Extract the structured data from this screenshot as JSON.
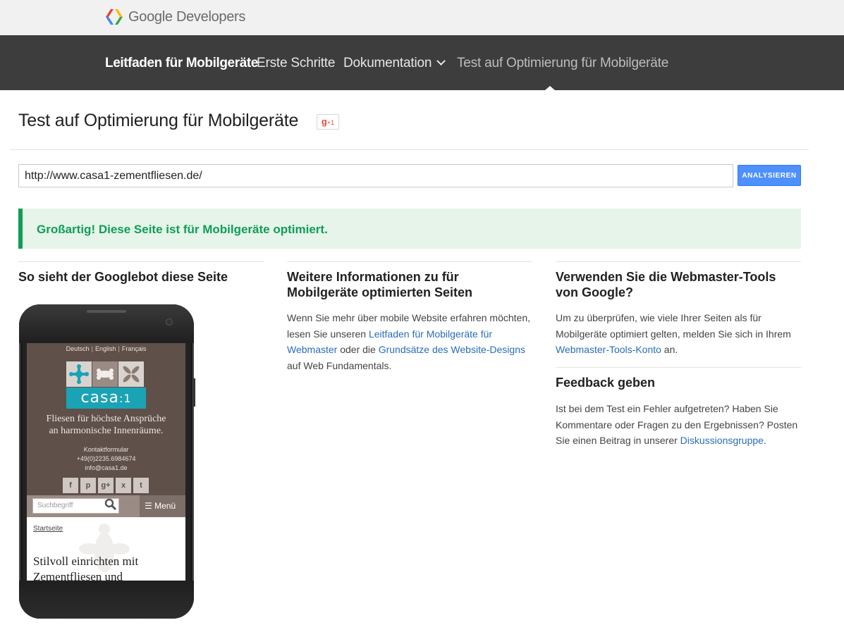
{
  "header": {
    "logo_text": "Google Developers"
  },
  "nav": {
    "brand": "Leitfaden für Mobilgeräte",
    "items": [
      {
        "label": "Erste Schritte"
      },
      {
        "label": "Dokumentation"
      },
      {
        "label": "Test auf Optimierung für Mobilgeräte"
      }
    ]
  },
  "page": {
    "title": "Test auf Optimierung für Mobilgeräte",
    "gplus_label": "g",
    "gplus_count": "+1"
  },
  "form": {
    "url_value": "http://www.casa1-zementfliesen.de/",
    "analyze_label": "ANALYSIEREN"
  },
  "result": {
    "message": "Großartig! Diese Seite ist für Mobilgeräte optimiert."
  },
  "columns": {
    "googlebot": {
      "heading": "So sieht der Googlebot diese Seite"
    },
    "info": {
      "heading": "Weitere Informationen zu für Mobilgeräte optimierten Seiten",
      "text_1": "Wenn Sie mehr über mobile Website erfahren möchten, lesen Sie unseren ",
      "link_1": "Leitfaden für Mobilgeräte für Webmaster",
      "text_2": " oder die ",
      "link_2": "Grundsätze des Website-Designs",
      "text_3": " auf Web Fundamentals."
    },
    "webmaster": {
      "heading": "Verwenden Sie die Webmaster-Tools von Google?",
      "text_1": "Um zu überprüfen, wie viele Ihrer Seiten als für Mobilgeräte optimiert gelten, melden Sie sich in Ihrem ",
      "link_1": "Webmaster-Tools-Konto",
      "text_2": " an."
    },
    "feedback": {
      "heading": "Feedback geben",
      "text_1": "Ist bei dem Test ein Fehler aufgetreten? Haben Sie Kommentare oder Fragen zu den Ergebnissen? Posten Sie einen Beitrag in unserer ",
      "link_1": "Diskussionsgruppe",
      "text_2": "."
    }
  },
  "preview": {
    "languages": [
      "Deutsch",
      "English",
      "Français"
    ],
    "brand_name": "casa",
    "brand_suffix": ":1",
    "tagline_1": "Fliesen für höchste Ansprüche",
    "tagline_2": "an harmonische Innenräume.",
    "contact_form": "Kontaktformular",
    "phone": "+49(0)2235.6984674",
    "email": "info@casa1.de",
    "social": [
      "f",
      "p",
      "g+",
      "x",
      "t"
    ],
    "search_placeholder": "Suchbegriff",
    "menu_label": "Menü",
    "breadcrumb": "Startseite",
    "headline_1": "Stilvoll einrichten mit",
    "headline_2": "Zementfliesen und"
  },
  "colors": {
    "nav_bg": "#3d3d3d",
    "success_green": "#0f9d58",
    "success_bg": "#e6f4ea",
    "button_blue": "#4d90fe",
    "link_blue": "#2a6db8",
    "preview_brand": "#1aa3b5"
  }
}
